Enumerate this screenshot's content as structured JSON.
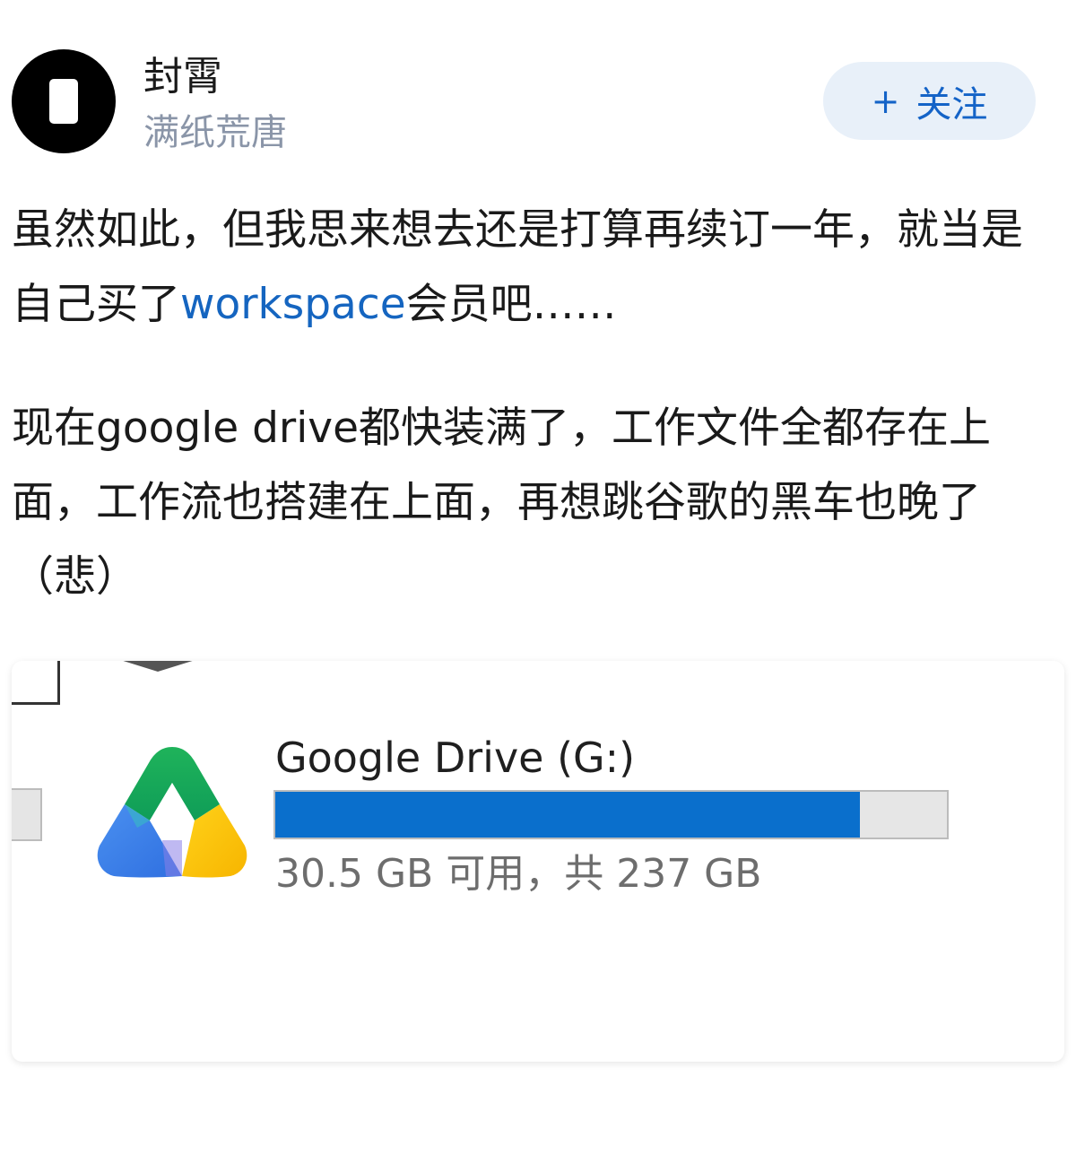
{
  "header": {
    "user_name": "封霄",
    "user_bio": "满纸荒唐",
    "follow_icon": "+",
    "follow_label": "关注"
  },
  "post": {
    "para1_before": "虽然如此，但我思来想去还是打算再续订一年，就当是自己买了",
    "para1_link": "workspace",
    "para1_after": "会员吧……",
    "para2": "现在google drive都快装满了，工作文件全都存在上面，工作流也搭建在上面，再想跳谷歌的黑车也晚了（悲）"
  },
  "image": {
    "drive_title": "Google Drive (G:)",
    "drive_space_text": "30.5 GB 可用，共 237 GB",
    "used_fraction": 0.871,
    "bar_color": "#0a6fcc"
  },
  "colors": {
    "link": "#1565c0",
    "follow_bg": "#e8f0f9",
    "follow_text": "#1463c7",
    "bio": "#8a95a8"
  }
}
